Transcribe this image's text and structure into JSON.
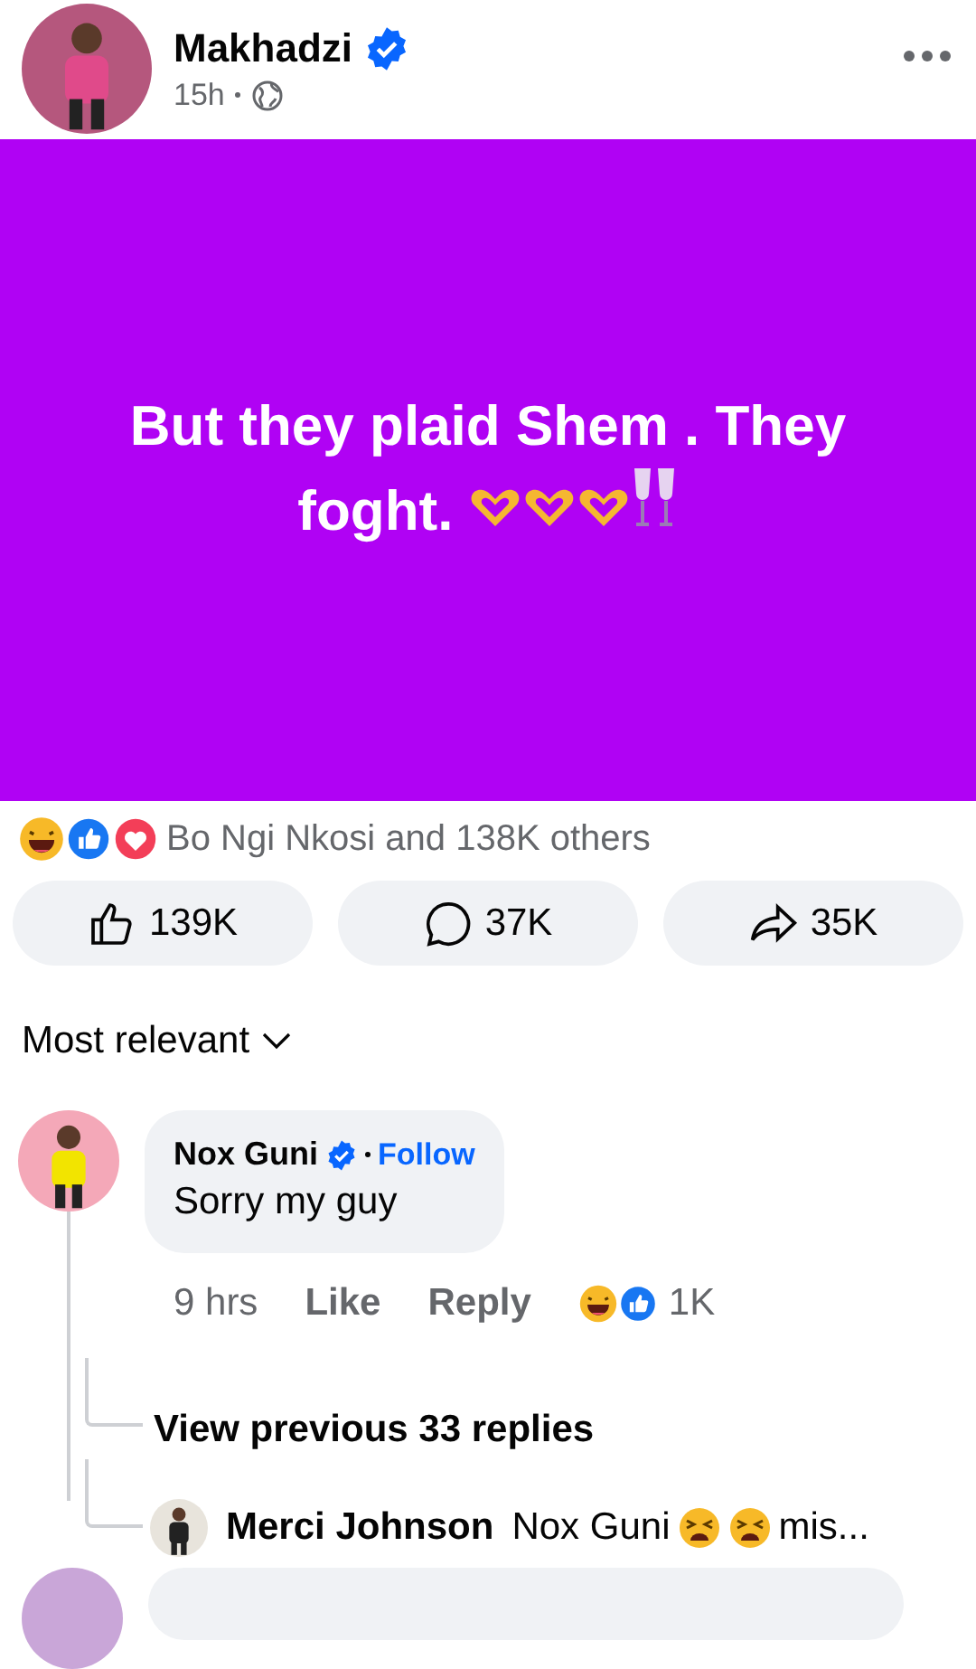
{
  "post": {
    "author": "Makhadzi",
    "verified": true,
    "time": "15h",
    "text": "But they plaid Shem . They foght."
  },
  "reactions": {
    "summary": "Bo Ngi Nkosi and 138K others"
  },
  "actions": [
    {
      "kind": "like",
      "count": "139K"
    },
    {
      "kind": "comment",
      "count": "37K"
    },
    {
      "kind": "share",
      "count": "35K"
    }
  ],
  "sort": "Most relevant",
  "comment": {
    "author": "Nox Guni",
    "verified": true,
    "follow": "Follow",
    "text": "Sorry my guy",
    "time": "9 hrs",
    "like": "Like",
    "reply": "Reply",
    "reaction_count": "1K"
  },
  "replies": {
    "view_previous": "View previous 33 replies",
    "latest": {
      "author": "Merci Johnson",
      "mention": "Nox Guni",
      "text": "mis..."
    }
  }
}
